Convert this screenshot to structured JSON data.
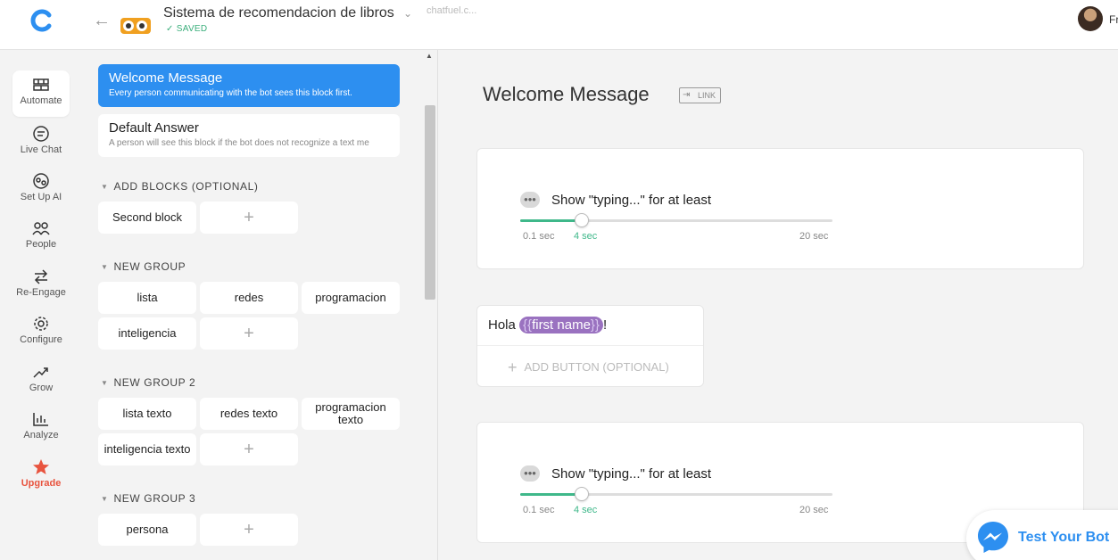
{
  "topbar": {
    "bot_title": "Sistema de recomendacion de libros",
    "saved_label": "SAVED",
    "url_text": "chatfuel.c...",
    "user_name": "Fr"
  },
  "nav": [
    {
      "label": "Automate",
      "icon": "automate-icon"
    },
    {
      "label": "Live Chat",
      "icon": "chat-icon"
    },
    {
      "label": "Set Up AI",
      "icon": "ai-icon"
    },
    {
      "label": "People",
      "icon": "people-icon"
    },
    {
      "label": "Re-Engage",
      "icon": "reengage-icon"
    },
    {
      "label": "Configure",
      "icon": "gear-icon"
    },
    {
      "label": "Grow",
      "icon": "grow-icon"
    },
    {
      "label": "Analyze",
      "icon": "analyze-icon"
    },
    {
      "label": "Upgrade",
      "icon": "star-icon"
    }
  ],
  "blocks": {
    "welcome": {
      "title": "Welcome Message",
      "subtitle": "Every person communicating with the bot sees this block first."
    },
    "default": {
      "title": "Default Answer",
      "subtitle": "A person will see this block if the bot does not recognize a text me"
    },
    "groups": [
      {
        "title": "ADD BLOCKS (OPTIONAL)",
        "items": [
          "Second block"
        ]
      },
      {
        "title": "NEW GROUP",
        "items": [
          "lista",
          "redes",
          "programacion",
          "inteligencia"
        ]
      },
      {
        "title": "NEW GROUP 2",
        "items": [
          "lista texto",
          "redes texto",
          "programacion texto",
          "inteligencia texto"
        ]
      },
      {
        "title": "NEW GROUP 3",
        "items": [
          "persona"
        ]
      }
    ],
    "add_symbol": "+"
  },
  "main": {
    "page_title": "Welcome Message",
    "link_label": "LINK",
    "typing_label": "Show \"typing...\" for at least",
    "typing_cards": [
      {
        "min_label": "0.1 sec",
        "value_label": "4 sec",
        "max_label": "20 sec",
        "value": 4,
        "min": 0.1,
        "max": 20
      },
      {
        "min_label": "0.1 sec",
        "value_label": "4 sec",
        "max_label": "20 sec",
        "value": 4,
        "min": 0.1,
        "max": 20
      }
    ],
    "text_card": {
      "prefix": "Hola ",
      "attribute": "first name",
      "suffix": "!",
      "add_button": "ADD BUTTON (OPTIONAL)"
    },
    "test_bot": "Test Your Bot"
  },
  "colors": {
    "accent": "#2d8ff0",
    "green": "#3fb88a",
    "attribute": "#9a72c0",
    "upgrade": "#e8543f"
  }
}
